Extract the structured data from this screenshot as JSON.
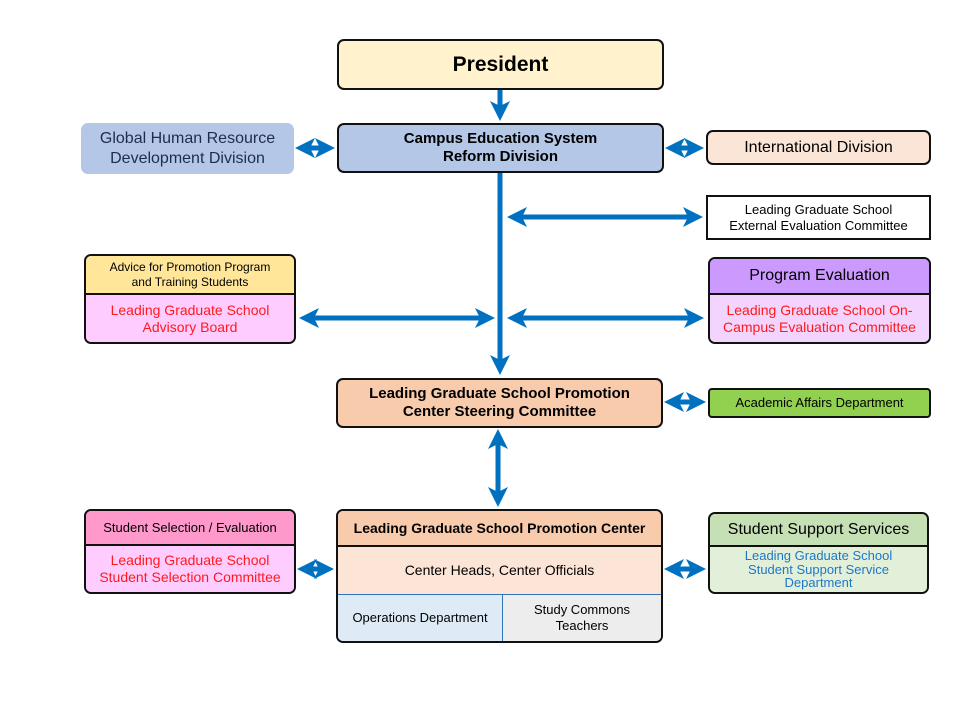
{
  "president": "President",
  "campus": {
    "line1": "Campus Education System",
    "line2": "Reform Division"
  },
  "global_hr": {
    "line1": "Global Human Resource",
    "line2": "Development Division"
  },
  "international": "International Division",
  "external_eval": {
    "line1": "Leading Graduate School",
    "line2": "External Evaluation Committee"
  },
  "advisory": {
    "header1": "Advice for Promotion Program",
    "header2": "and Training Students",
    "body1": "Leading Graduate School",
    "body2": "Advisory Board"
  },
  "program_eval": {
    "header": "Program Evaluation",
    "body1": "Leading Graduate School On-",
    "body2": "Campus Evaluation Committee"
  },
  "steering": {
    "line1": "Leading Graduate School Promotion",
    "line2": "Center Steering Committee"
  },
  "academic": "Academic Affairs Department",
  "selection": {
    "header": "Student Selection / Evaluation",
    "body1": "Leading Graduate School",
    "body2": "Student Selection Committee"
  },
  "center": {
    "header": "Leading Graduate School Promotion Center",
    "middle": "Center Heads, Center Officials",
    "left": "Operations Department",
    "right1": "Study Commons",
    "right2": "Teachers"
  },
  "support": {
    "header": "Student Support Services",
    "body1": "Leading Graduate School",
    "body2": "Student Support Service",
    "body3": "Department"
  },
  "colors": {
    "arrow": "#0070c0"
  }
}
